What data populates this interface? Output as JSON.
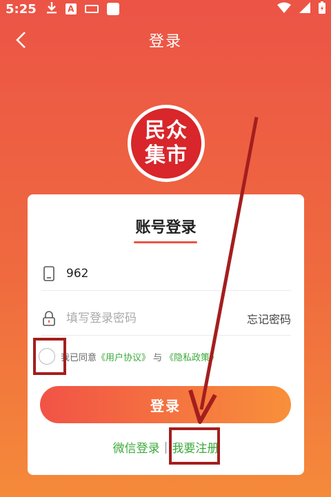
{
  "status_bar": {
    "time": "5:25",
    "a_icon_text": "A"
  },
  "navbar": {
    "title": "登录"
  },
  "logo": {
    "line1": "民众",
    "line2": "集市"
  },
  "card": {
    "title": "账号登录",
    "phone": {
      "value": "962"
    },
    "password": {
      "placeholder": "填写登录密码",
      "forgot_label": "忘记密码"
    },
    "agreement": {
      "prefix": "我已同意",
      "user_agreement": "《用户协议》",
      "and": "与",
      "privacy_policy": "《隐私政策》"
    },
    "login_button": "登录",
    "wechat_login": "微信登录",
    "separator": "|",
    "register": "我要注册"
  },
  "colors": {
    "accent": "#ec5446",
    "link_green": "#3aaa3a",
    "annotation": "#a41e1e"
  }
}
